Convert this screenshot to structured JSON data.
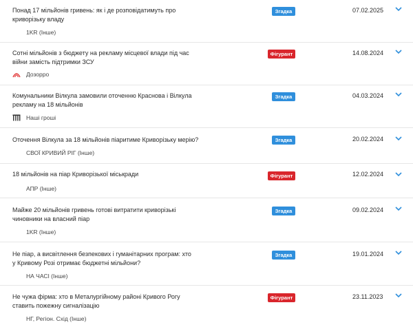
{
  "colors": {
    "mention": "#2f8fdc",
    "figurant": "#d9262c",
    "chevron": "#2f8fdc"
  },
  "items": [
    {
      "title": "Понад 17 мільйонів гривень: як і де розповідатимуть про криворізьку владу",
      "badge": "Згадка",
      "badge_type": "mention",
      "date": "07.02.2025",
      "source": "1KR (Інше)",
      "source_icon": ""
    },
    {
      "title": "Сотні мільйонів з бюджету на рекламу місцевої влади під час війни замість підтримки ЗСУ",
      "badge": "Фігурант",
      "badge_type": "figurant",
      "date": "14.08.2024",
      "source": "Дозорро",
      "source_icon": "dozorro-logo-icon"
    },
    {
      "title": "Комунальники Вілкула замовили оточенню Краснова і Вілкула рекламу на 18 мільйонів",
      "badge": "Згадка",
      "badge_type": "mention",
      "date": "04.03.2024",
      "source": "Наші гроші",
      "source_icon": "nashi-groshi-logo-icon"
    },
    {
      "title": "Оточення Вілкула за 18 мільйонів піаритиме Криворізьку мерію?",
      "badge": "Згадка",
      "badge_type": "mention",
      "date": "20.02.2024",
      "source": "СВОЇ КРИВИЙ РІГ (Інше)",
      "source_icon": ""
    },
    {
      "title": "18 мільйонів на піар Криворізької міськради",
      "badge": "Фігурант",
      "badge_type": "figurant",
      "date": "12.02.2024",
      "source": "АПР (Інше)",
      "source_icon": ""
    },
    {
      "title": "Майже 20 мільйонів гривень готові витратити криворізькі чиновники на власний піар",
      "badge": "Згадка",
      "badge_type": "mention",
      "date": "09.02.2024",
      "source": "1KR (Інше)",
      "source_icon": ""
    },
    {
      "title": "Не піар, а висвітлення безпекових і гуманітарних програм: хто у Кривому Розі отримає бюджетні мільйони?",
      "badge": "Згадка",
      "badge_type": "mention",
      "date": "19.01.2024",
      "source": "НА ЧАСІ (Інше)",
      "source_icon": ""
    },
    {
      "title": "Не чужа фірма: хто в Металургійному районі Кривого Рогу ставить пожежну сигналізацію",
      "badge": "Фігурант",
      "badge_type": "figurant",
      "date": "23.11.2023",
      "source": "НГ, Регіон. Схід (Інше)",
      "source_icon": ""
    }
  ]
}
